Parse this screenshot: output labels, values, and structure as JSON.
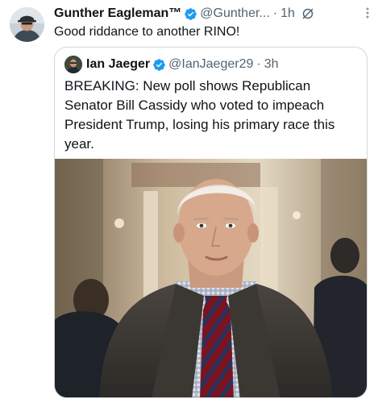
{
  "tweet": {
    "author_name": "Gunther Eagleman™",
    "handle": "@Gunther...",
    "separator": "·",
    "time": "1h",
    "text": "Good riddance to another RINO!"
  },
  "quote": {
    "author_name": "Ian Jaeger",
    "handle": "@IanJaeger29",
    "separator": "·",
    "time": "3h",
    "text": "BREAKING: New poll shows Republican Senator Bill Cassidy who voted to impeach President Trump, losing his primary race this year."
  },
  "icons": {
    "verified": "verified-badge-icon",
    "grok": "grok-icon",
    "more": "more-options-icon"
  },
  "colors": {
    "verified_blue": "#1d9bf0",
    "secondary_text": "#536471",
    "border": "#cfd9de"
  }
}
